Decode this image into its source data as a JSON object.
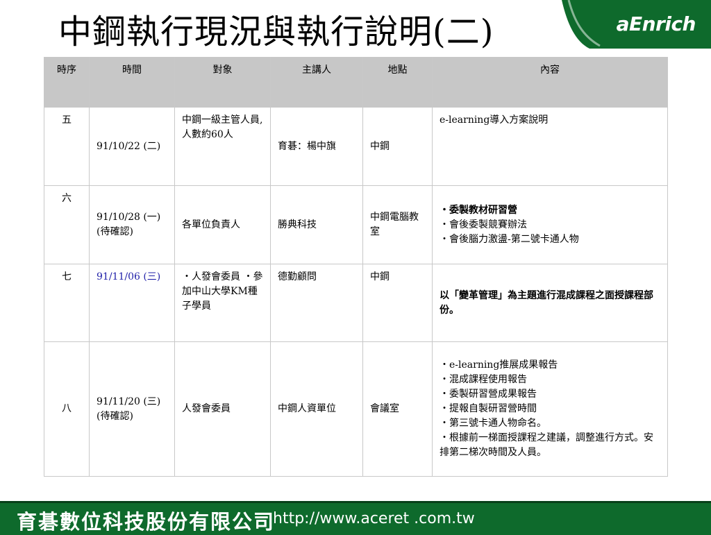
{
  "slide": {
    "title": "中鋼執行現況與執行說明(二)",
    "logo_text": "aEnrich"
  },
  "table": {
    "headers": [
      "時序",
      "時間",
      "對象",
      "主講人",
      "地點",
      "內容"
    ],
    "rows": [
      {
        "seq": "五",
        "time": "91/10/22 (二)",
        "audience": "中鋼一級主管人員,人數約60人",
        "speaker": "育碁：楊中旗",
        "location": "中鋼",
        "content": [
          "e-learning導入方案說明"
        ]
      },
      {
        "seq": "六",
        "time": "91/10/28 (一) (待確認)",
        "audience": "各單位負責人",
        "speaker": "勝典科技",
        "location": "中鋼電腦教室",
        "content": [
          "・委製教材研習營",
          "・會後委製競賽辦法",
          "・會後腦力激盪-第二號卡通人物"
        ]
      },
      {
        "seq": "七",
        "time": "91/11/06 (三)",
        "audience": "・人發會委員 ・參加中山大學KM種子學員",
        "speaker": "德勤顧問",
        "location": "中鋼",
        "content": [
          "以「變革管理」為主題進行混成課程之面授課程部份。"
        ]
      },
      {
        "seq": "八",
        "time": "91/11/20 (三) (待確認)",
        "audience": "人發會委員",
        "speaker": "中鋼人資單位",
        "location": "會議室",
        "content": [
          "・e-learning推展成果報告",
          "・混成課程使用報告",
          "・委製研習營成果報告",
          "・提報自製研習營時間",
          "・第三號卡通人物命名。",
          "・根據前一梯面授課程之建議，調整進行方式。安排第二梯次時間及人員。"
        ]
      }
    ]
  },
  "footer": {
    "company": "育碁數位科技股份有限公司",
    "url": "http://www.aceret .com.tw"
  },
  "colors": {
    "header_bg": "#c7c7c7",
    "footer_bg": "#0e6a2c",
    "logo_green": "#0e6a2c",
    "date_blue": "#1f1fa8"
  }
}
